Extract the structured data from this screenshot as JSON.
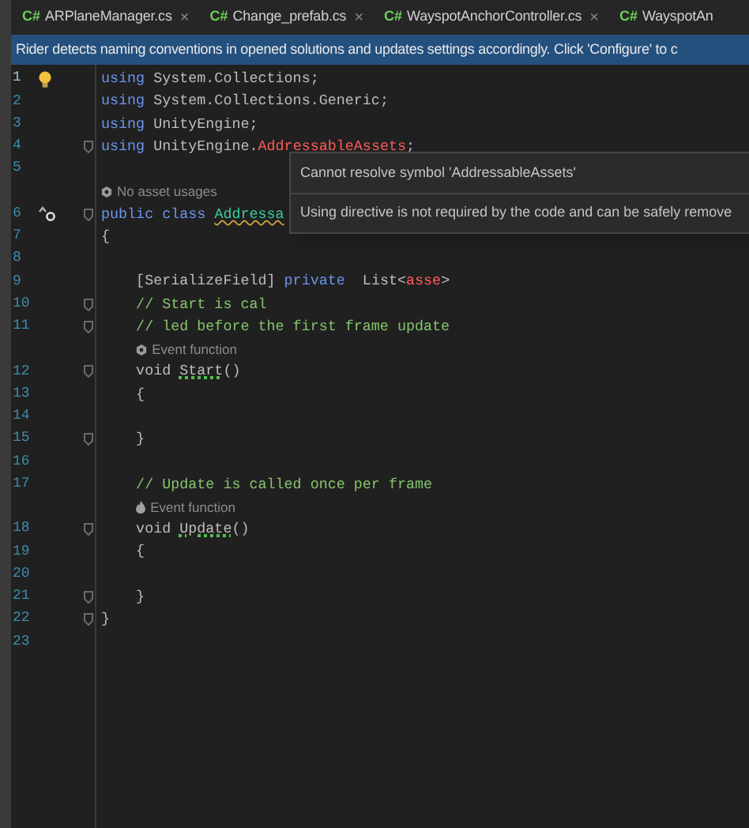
{
  "tabs": [
    {
      "icon_text": "C#",
      "label": "ARPlaneManager.cs",
      "close": "×",
      "selected": false
    },
    {
      "icon_text": "C#",
      "label": "Change_prefab.cs",
      "close": "×",
      "selected": false
    },
    {
      "icon_text": "C#",
      "label": "WayspotAnchorController.cs",
      "close": "×",
      "selected": false
    },
    {
      "icon_text": "C#",
      "label": "WayspotAn",
      "selected": false
    }
  ],
  "banner": "Rider detects naming conventions in opened solutions and updates settings accordingly. Click 'Configure' to c",
  "lines": [
    {
      "number": "1",
      "current": true,
      "gutter": {
        "kind": "bulb"
      },
      "tokens": [
        {
          "kind": "keyword",
          "text": "using"
        },
        {
          "kind": "plain",
          "text": " System.Collections;"
        }
      ]
    },
    {
      "number": "2",
      "current": false,
      "tokens": [
        {
          "kind": "keyword",
          "text": "using"
        },
        {
          "kind": "plain",
          "text": " System.Collections.Generic;"
        }
      ]
    },
    {
      "number": "3",
      "current": false,
      "tokens": [
        {
          "kind": "keyword",
          "text": "using"
        },
        {
          "kind": "plain",
          "text": " UnityEngine;"
        }
      ]
    },
    {
      "number": "4",
      "current": false,
      "fold": true,
      "tokens": [
        {
          "kind": "keyword",
          "text": "using"
        },
        {
          "kind": "plain",
          "text": " UnityEngine."
        },
        {
          "kind": "error",
          "text": "AddressableAssets"
        },
        {
          "kind": "plain",
          "text": ";"
        }
      ]
    },
    {
      "number": "5",
      "current": false
    },
    {
      "number": "6",
      "current": false,
      "fold": true,
      "gutter": {
        "kind": "inherit"
      },
      "hint": {
        "kind": "unity",
        "text": "No asset usages"
      },
      "tokens": [
        {
          "kind": "keyword",
          "text": "public class "
        },
        {
          "kind": "type",
          "text": "Addressa",
          "squiggle": true
        }
      ]
    },
    {
      "number": "7",
      "current": false,
      "tokens": [
        {
          "kind": "plain",
          "text": "{"
        }
      ]
    },
    {
      "number": "8",
      "current": false
    },
    {
      "number": "9",
      "current": false,
      "tokens": [
        {
          "kind": "plain",
          "text": "    [SerializeField] "
        },
        {
          "kind": "keyword",
          "text": "private"
        },
        {
          "kind": "plain",
          "text": "  List<"
        },
        {
          "kind": "error",
          "text": "asse"
        },
        {
          "kind": "plain",
          "text": ">"
        }
      ]
    },
    {
      "number": "10",
      "current": false,
      "fold": true,
      "tokens": [
        {
          "kind": "comment",
          "text": "    // Start is cal"
        }
      ]
    },
    {
      "number": "11",
      "current": false,
      "fold": true,
      "tokens": [
        {
          "kind": "comment",
          "text": "    // led before the first frame update"
        }
      ]
    },
    {
      "number": "12",
      "current": false,
      "fold": true,
      "hint": {
        "kind": "unity",
        "text": "Event function"
      },
      "tokens": [
        {
          "kind": "plain",
          "text": "    void "
        },
        {
          "kind": "plain",
          "text": "Start",
          "squiggle": true
        },
        {
          "kind": "plain",
          "text": "()"
        }
      ]
    },
    {
      "number": "13",
      "current": false,
      "tokens": [
        {
          "kind": "plain",
          "text": "    {"
        }
      ]
    },
    {
      "number": "14",
      "current": false
    },
    {
      "number": "15",
      "current": false,
      "fold": true,
      "tokens": [
        {
          "kind": "plain",
          "text": "    }"
        }
      ]
    },
    {
      "number": "16",
      "current": false
    },
    {
      "number": "17",
      "current": false,
      "tokens": [
        {
          "kind": "comment",
          "text": "    // Update is called once per frame"
        }
      ]
    },
    {
      "number": "18",
      "current": false,
      "fold": true,
      "hint": {
        "kind": "hot",
        "text": "Event function"
      },
      "tokens": [
        {
          "kind": "plain",
          "text": "    void "
        },
        {
          "kind": "plain",
          "text": "Update",
          "squiggle": true
        },
        {
          "kind": "plain",
          "text": "()"
        }
      ]
    },
    {
      "number": "19",
      "current": false,
      "tokens": [
        {
          "kind": "plain",
          "text": "    {"
        }
      ]
    },
    {
      "number": "20",
      "current": false
    },
    {
      "number": "21",
      "current": false,
      "fold": true,
      "tokens": [
        {
          "kind": "plain",
          "text": "    }"
        }
      ]
    },
    {
      "number": "22",
      "current": false,
      "fold": true,
      "tokens": [
        {
          "kind": "plain",
          "text": "}"
        }
      ]
    },
    {
      "number": "23",
      "current": false
    }
  ],
  "tooltip": [
    "Cannot resolve symbol 'AddressableAssets'",
    "Using directive is not required by the code and can be safely remove"
  ]
}
